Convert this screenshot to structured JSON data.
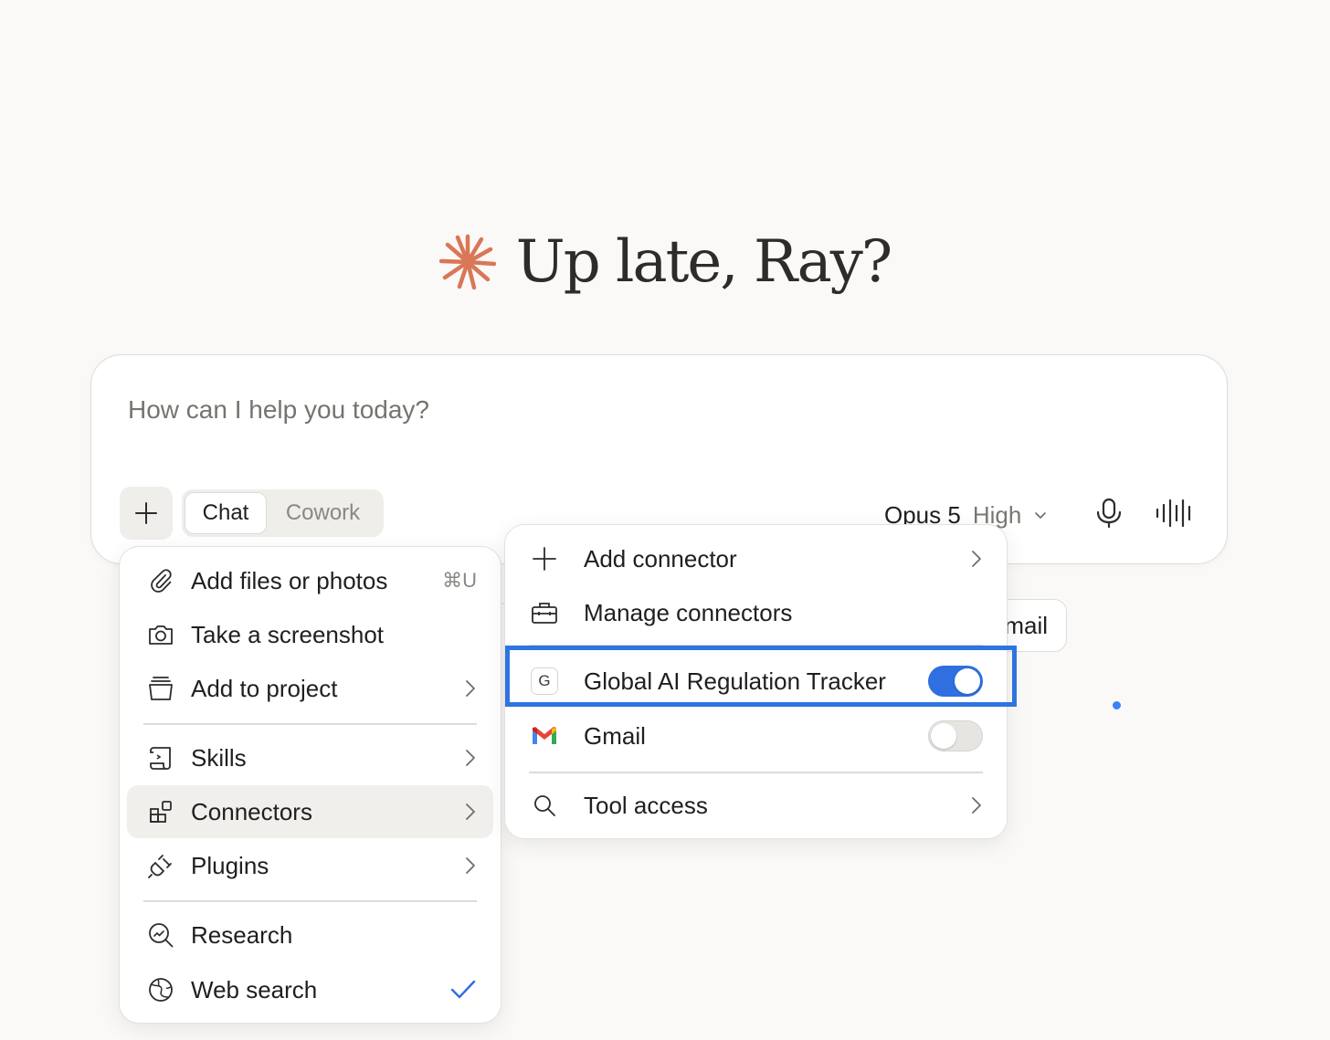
{
  "greeting": {
    "text": "Up late, Ray?",
    "icon": "starburst-icon",
    "icon_color": "#d97757"
  },
  "composer": {
    "placeholder": "How can I help you today?",
    "modes": [
      "Chat",
      "Cowork"
    ],
    "active_mode": "Chat",
    "model": "Opus 5",
    "effort": "High"
  },
  "background_chip": {
    "label": "mail"
  },
  "attach_menu": {
    "items": [
      {
        "label": "Add files or photos",
        "icon": "paperclip-icon",
        "shortcut": "⌘U"
      },
      {
        "label": "Take a screenshot",
        "icon": "camera-icon"
      },
      {
        "label": "Add to project",
        "icon": "project-box-icon",
        "has_submenu": true
      },
      {
        "label": "Skills",
        "icon": "scroll-icon",
        "has_submenu": true
      },
      {
        "label": "Connectors",
        "icon": "connectors-icon",
        "has_submenu": true,
        "highlighted": true
      },
      {
        "label": "Plugins",
        "icon": "plug-icon",
        "has_submenu": true
      },
      {
        "label": "Research",
        "icon": "research-icon"
      },
      {
        "label": "Web search",
        "icon": "globe-icon",
        "checked": true
      }
    ]
  },
  "connectors_menu": {
    "items": [
      {
        "label": "Add connector",
        "icon": "plus-icon",
        "has_submenu": true
      },
      {
        "label": "Manage connectors",
        "icon": "toolbox-icon"
      },
      {
        "label": "Global AI Regulation Tracker",
        "icon": "G",
        "toggle": true,
        "enabled": true
      },
      {
        "label": "Gmail",
        "icon": "gmail-icon",
        "toggle": true,
        "enabled": false
      },
      {
        "label": "Tool access",
        "icon": "search-icon",
        "has_submenu": true
      }
    ]
  },
  "colors": {
    "accent_blue": "#2f6fe0",
    "brand_orange": "#d97757",
    "highlight_border": "#2f74e0"
  }
}
